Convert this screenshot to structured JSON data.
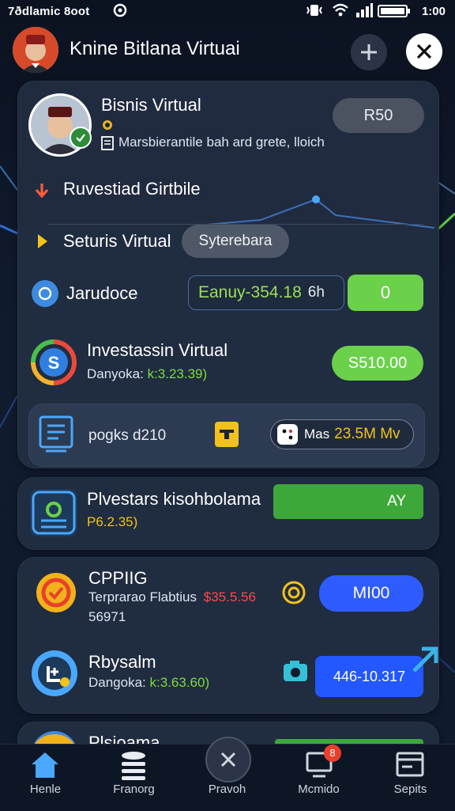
{
  "status_bar": {
    "left_text": "7ðdlamic 8oot",
    "time": "1:00"
  },
  "header": {
    "title": "Knine Bitlana Virtuai"
  },
  "profile_card": {
    "name": "Bisnis Virtual",
    "subtitle": "Marsbierantile bah ard grete, lloich",
    "button": "R50"
  },
  "rows": {
    "row1_label": "Ruvestiad Girtbile",
    "row2_label": "Seturis Virtual",
    "row2_chip": "Syterebara",
    "row3_label": "Jarudoce",
    "row3_value": "Eanuy-354.18",
    "row3_unit": "6h",
    "row3_button": "0"
  },
  "investment": {
    "title": "Investassin Virtual",
    "sub_prefix": "Danyoka:",
    "sub_value": "k:3.23.39)",
    "button": "S510.00"
  },
  "inner_row": {
    "label": "pogks d210",
    "chip_prefix": "Mas",
    "chip_value": "23.5M Mv"
  },
  "card2": {
    "title": "Plvestars kisohbolama",
    "sub": "P6.2.35)",
    "button": "AY"
  },
  "card3": {
    "item1_title": "CPPIIG",
    "item1_sub_prefix": "Terprarao Flabtius",
    "item1_sub_value": "$35.5.56",
    "item1_sub2": "56971",
    "item1_button": "MI00",
    "item2_title": "Rbysalm",
    "item2_sub_prefix": "Dangoka:",
    "item2_sub_value": "k:3.63.60)",
    "item2_button": "446-10.317"
  },
  "card4": {
    "title": "Plsioama"
  },
  "nav": [
    {
      "label": "Henle",
      "icon": "home-icon"
    },
    {
      "label": "Franorg",
      "icon": "stack-icon"
    },
    {
      "label": "Pravoh",
      "icon": "close-icon"
    },
    {
      "label": "Mcmido",
      "icon": "monitor-icon",
      "badge": "8"
    },
    {
      "label": "Sepits",
      "icon": "window-icon"
    }
  ],
  "colors": {
    "green": "#6bd14a",
    "blue": "#2f5cff",
    "card": "#222e42",
    "chip": "#3b4556"
  }
}
